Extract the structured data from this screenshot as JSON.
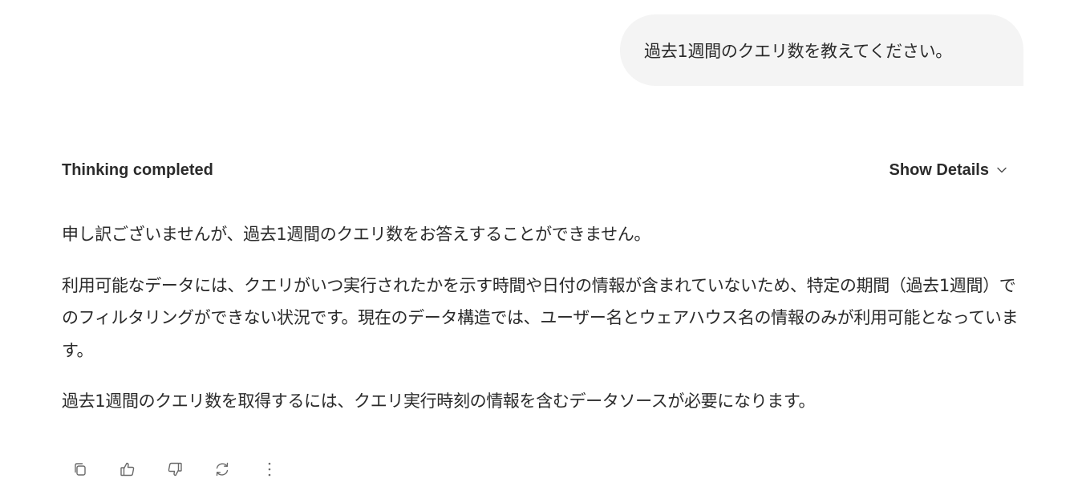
{
  "user_message": {
    "text": "過去1週間のクエリ数を教えてください。"
  },
  "thinking": {
    "status": "Thinking completed",
    "details_label": "Show Details",
    "details_icon": "chevron-down-icon"
  },
  "assistant_message": {
    "paragraphs": [
      "申し訳ございませんが、過去1週間のクエリ数をお答えすることができません。",
      "利用可能なデータには、クエリがいつ実行されたかを示す時間や日付の情報が含まれていないため、特定の期間（過去1週間）でのフィルタリングができない状況です。現在のデータ構造では、ユーザー名とウェアハウス名の情報のみが利用可能となっています。",
      "過去1週間のクエリ数を取得するには、クエリ実行時刻の情報を含むデータソースが必要になります。"
    ]
  },
  "actions": [
    {
      "icon": "copy-icon"
    },
    {
      "icon": "thumbs-up-icon"
    },
    {
      "icon": "thumbs-down-icon"
    },
    {
      "icon": "regenerate-icon"
    },
    {
      "icon": "more-options-icon"
    }
  ],
  "colors": {
    "text": "#2a2a2a",
    "bubble_background": "#f4f4f4",
    "icon": "#6b6b6b"
  }
}
